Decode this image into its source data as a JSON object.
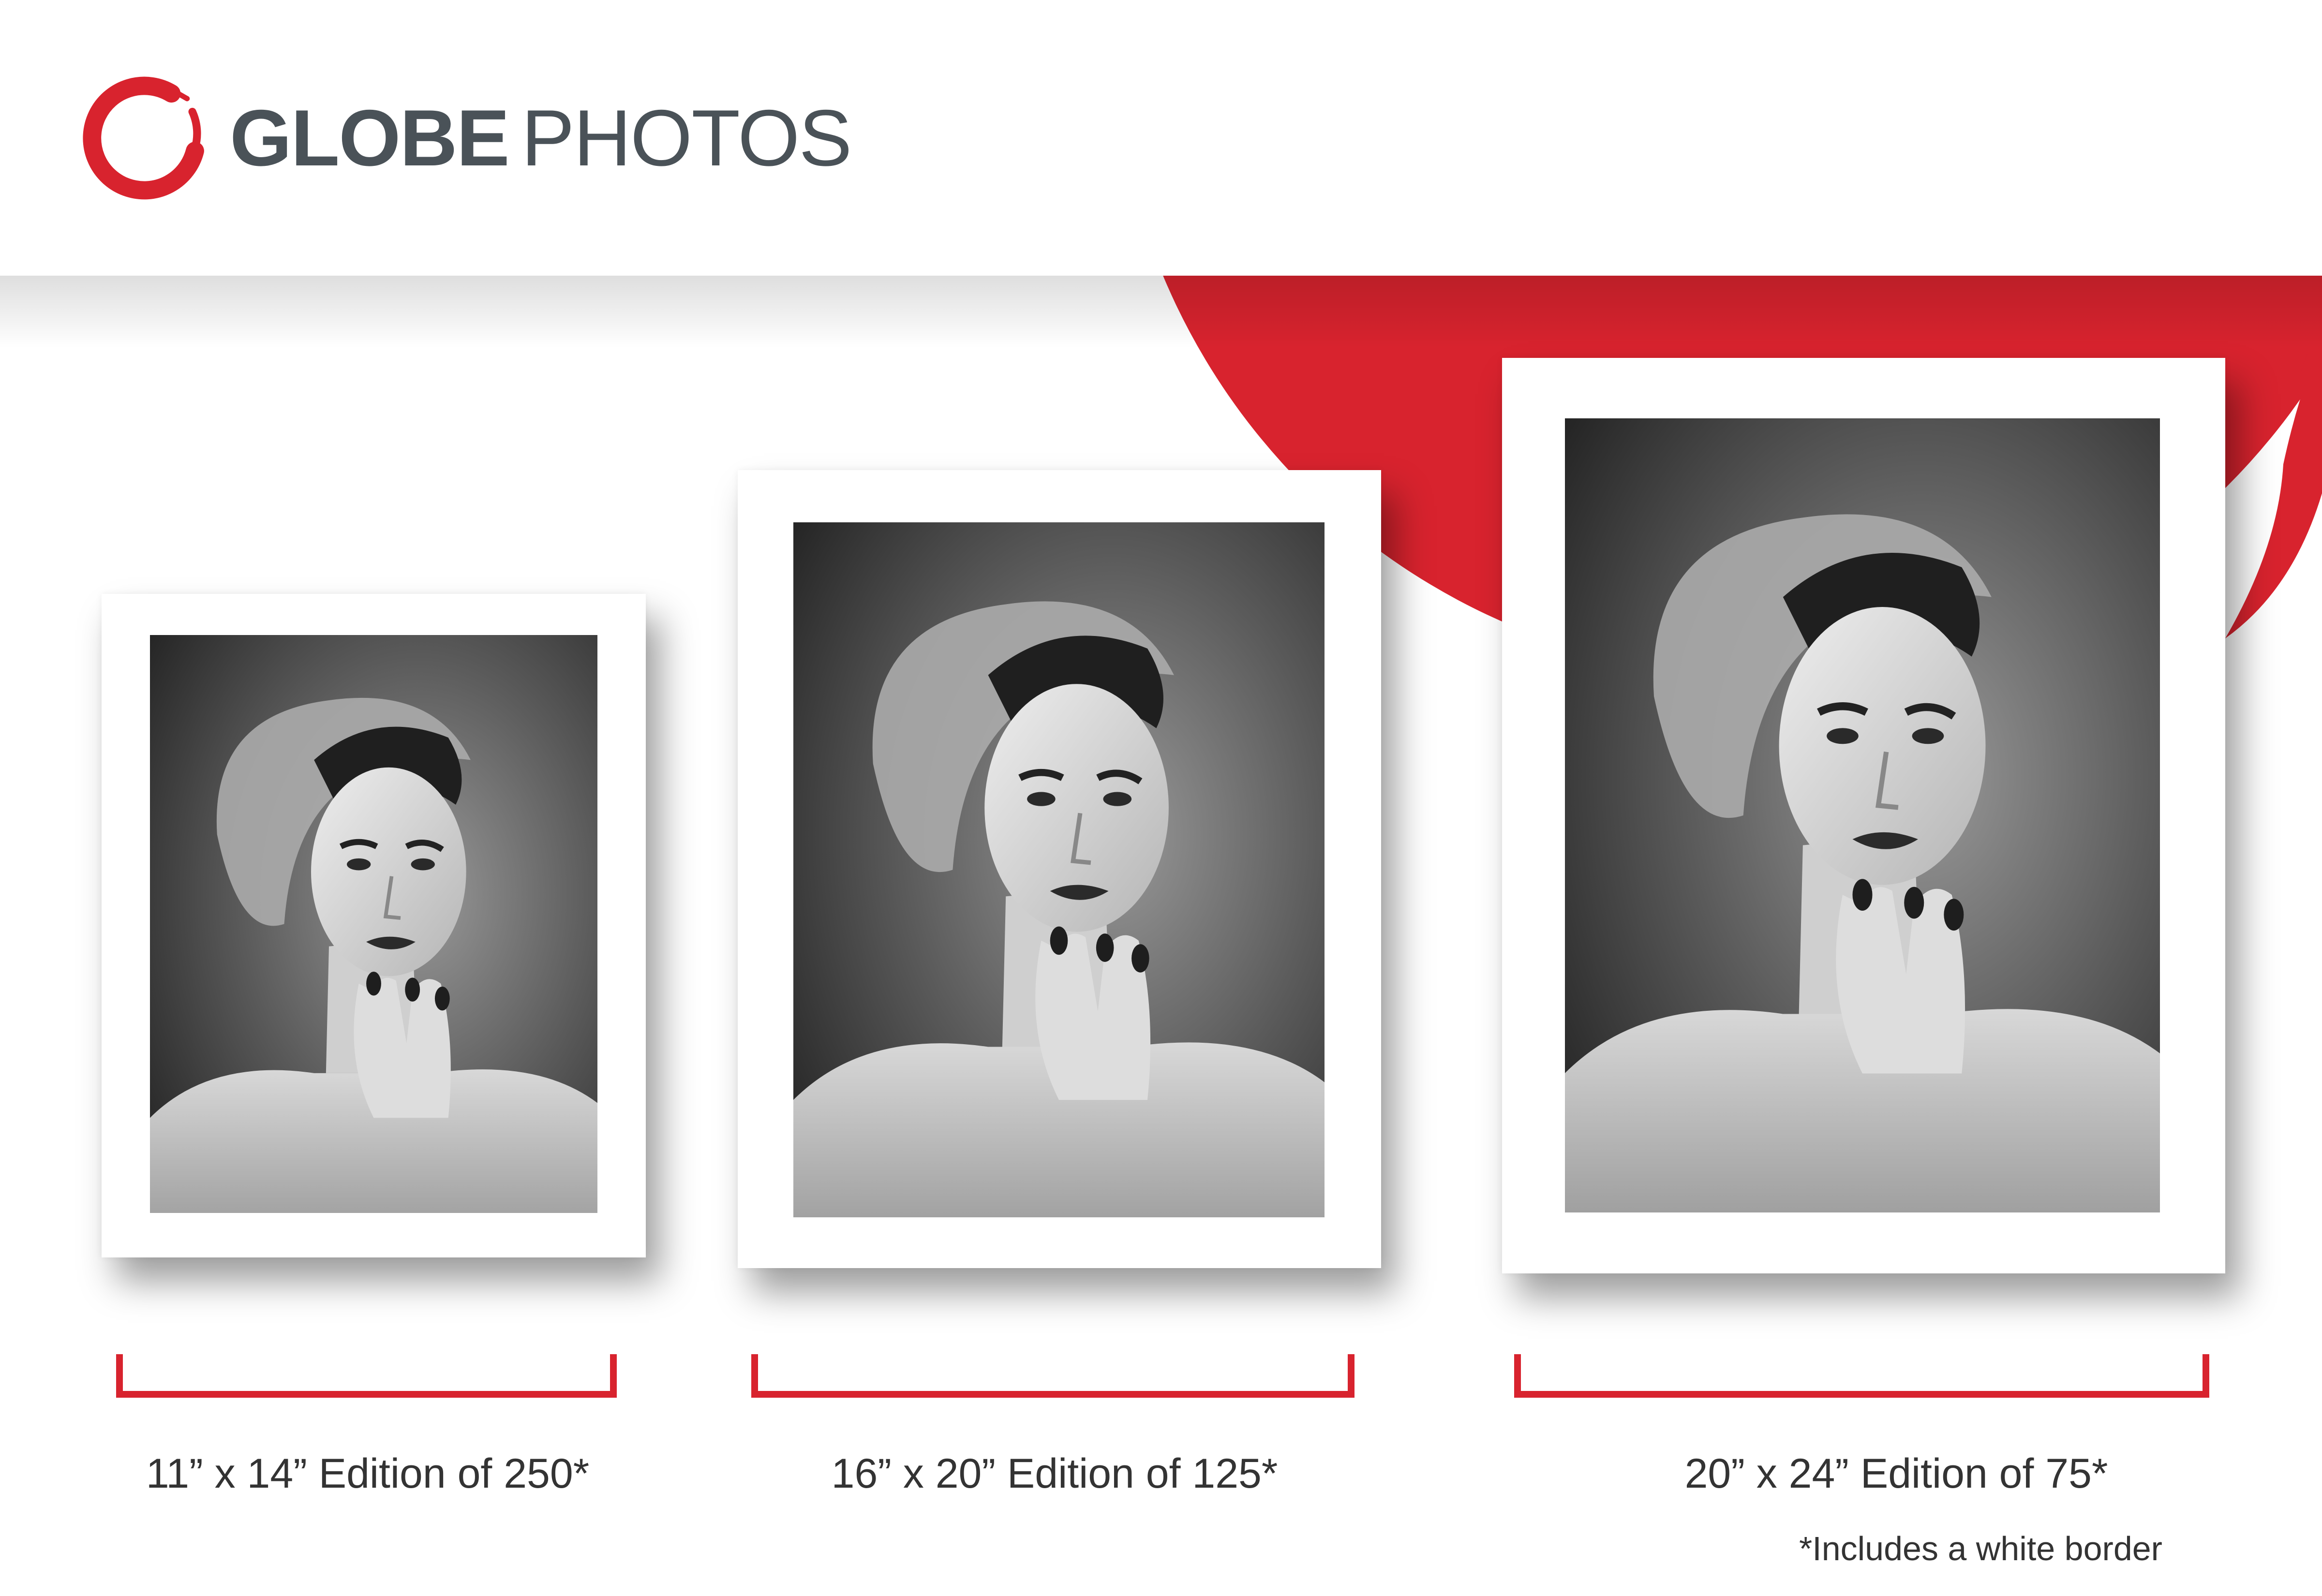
{
  "brand": {
    "name_bold": "GLOBE",
    "name_light": "PHOTOS",
    "accent_color": "#d8232e",
    "text_color": "#4a5258"
  },
  "prints": [
    {
      "size": "11” x 14”",
      "edition": "Edition of 250*",
      "caption": "11” x 14” Edition of 250*"
    },
    {
      "size": "16” x 20”",
      "edition": "Edition of 125*",
      "caption": "16” x 20” Edition of 125*"
    },
    {
      "size": "20” x 24”",
      "edition": "Edition of 75*",
      "caption": "20” x 24” Edition of 75*"
    }
  ],
  "footnote": "*Includes a white border",
  "photo_description_icon": "portrait-photo"
}
